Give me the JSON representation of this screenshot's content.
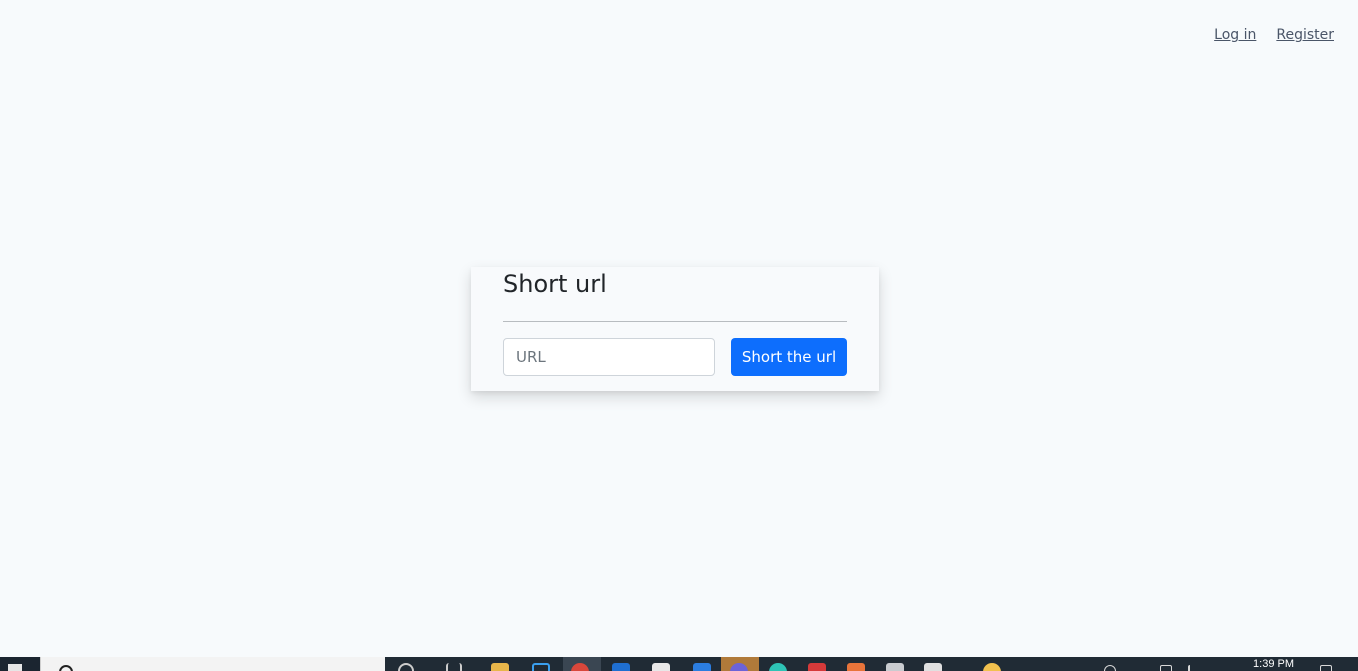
{
  "nav": {
    "login_label": "Log in",
    "register_label": "Register"
  },
  "card": {
    "title": "Short url",
    "url_placeholder": "URL",
    "url_value": "",
    "submit_label": "Short the url"
  },
  "taskbar": {
    "clock_time": "1:39 PM",
    "icons": [
      "task-view-icon",
      "file-explorer-icon",
      "store-icon",
      "chrome-icon",
      "vscode-icon",
      "app-icon",
      "app-icon",
      "app-icon",
      "app-icon",
      "app-icon",
      "app-icon",
      "app-icon",
      "app-icon"
    ]
  },
  "colors": {
    "page_background": "#f7fafc",
    "primary_button": "#0d6efd",
    "taskbar": "#202b35"
  }
}
